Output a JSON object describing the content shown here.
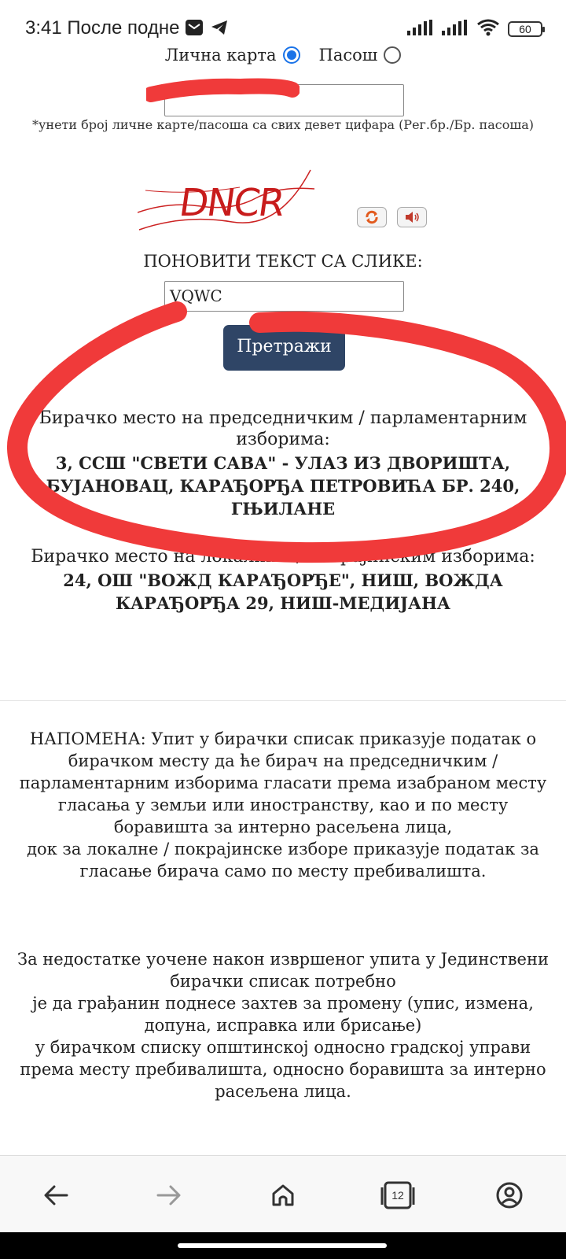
{
  "status_bar": {
    "time": "3:41 После подне",
    "battery": "60"
  },
  "form": {
    "id_card_label": "Лична карта",
    "passport_label": "Пасош",
    "id_type_selected": "Лична карта",
    "id_input_value": "",
    "hint": "*унети број личне карте/пасоша са свих девет цифара (Рег.бр./Бр. пасоша)",
    "captcha_image_text": "DNCR",
    "repeat_label": "ПОНОВИТИ ТЕКСТ СА СЛИКЕ:",
    "captcha_input_value": "VQWC",
    "search_button": "Претражи"
  },
  "results": {
    "presidential_label": "Бирачко место на председничким / парламентарним изборима:",
    "presidential_value": "3, ССШ \"СВЕТИ САВА\" - УЛАЗ ИЗ ДВОРИШТА, БУЈАНОВАЦ, КАРАЂОРЂА ПЕТРОВИЋА БР. 240, ГЊИЛАНЕ",
    "local_label": "Бирачко место на локалним / покрајинским изборима:",
    "local_value": "24, ОШ \"ВОЖД КАРАЂОРЂЕ\", НИШ, ВОЖДА КАРАЂОРЂА 29, НИШ-МЕДИЈАНА"
  },
  "notes": {
    "note_1": [
      "НАПОМЕНА: Упит у бирачки списак приказује податак о бирачком месту да ће бирач на председничким / парламентарним изборима гласати према изабраном месту гласања у земљи или иностранству, као и по месту боравишта за интерно расељена лица,",
      "док за локалне / покрајинске изборе приказује податак за гласање бирача само по месту пребивалишта."
    ],
    "note_2": [
      "За недостатке уочене након извршеног упита у Јединствени бирачки списак потребно",
      "је да грађанин поднесе захтев за промену (упис, измена, допуна, исправка или брисање)",
      "у бирачком списку општинској односно градској управи",
      "према месту пребивалишта, односно боравишта за интерно расељена лица."
    ]
  },
  "browser_bar": {
    "tab_count": "12"
  },
  "colors": {
    "button_bg": "#2f4566",
    "annotation_red": "#f03a3a",
    "radio_accent": "#1a73e8"
  }
}
